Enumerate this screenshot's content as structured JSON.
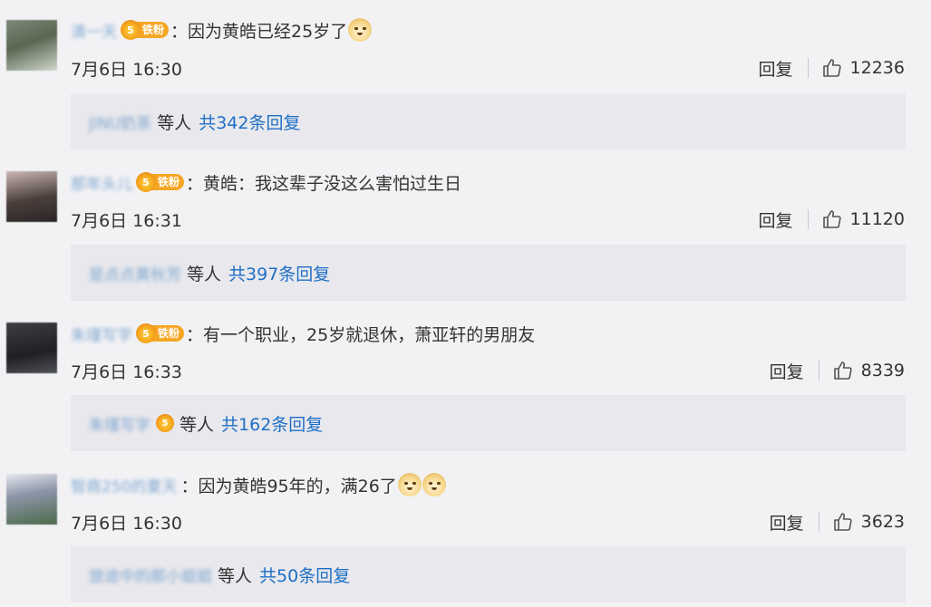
{
  "comments": [
    {
      "username": "清一天",
      "badge_label": "铁粉",
      "badge_level": "5",
      "text": "：因为黄皓已经25岁了",
      "emoji": [
        "doge-icon"
      ],
      "time": "7月6日 16:30",
      "reply_label": "回复",
      "likes": "12236",
      "sub_user": "JINU奶茶",
      "sub_deng": "等人",
      "sub_total": "共342条回复",
      "sub_has_badge": false
    },
    {
      "username": "那年头儿",
      "badge_label": "铁粉",
      "badge_level": "5",
      "text": "：黄皓：我这辈子没这么害怕过生日",
      "emoji": [],
      "time": "7月6日 16:31",
      "reply_label": "回复",
      "likes": "11120",
      "sub_user": "是点点黄秋芳",
      "sub_deng": "等人",
      "sub_total": "共397条回复",
      "sub_has_badge": false
    },
    {
      "username": "朱瑾写字",
      "badge_label": "铁粉",
      "badge_level": "5",
      "text": "：有一个职业，25岁就退休，萧亚轩的男朋友",
      "emoji": [],
      "time": "7月6日 16:33",
      "reply_label": "回复",
      "likes": "8339",
      "sub_user": "朱瑾写字",
      "sub_deng": "等人",
      "sub_total": "共162条回复",
      "sub_has_badge": true
    },
    {
      "username": "智商250的夏天",
      "badge_label": "",
      "badge_level": "",
      "text": "：因为黄皓95年的，满26了",
      "emoji": [
        "doge-icon",
        "doge-icon"
      ],
      "time": "7月6日 16:30",
      "reply_label": "回复",
      "likes": "3623",
      "sub_user": "旅途中的那小姐姐",
      "sub_deng": "等人",
      "sub_total": "共50条回复",
      "sub_has_badge": false
    }
  ],
  "colors": {
    "link": "#1f6fc5",
    "username": "#7ea6cf",
    "badge": "#f5a623",
    "background": "#f2f2f5",
    "reply_box": "#e8e8ed"
  }
}
